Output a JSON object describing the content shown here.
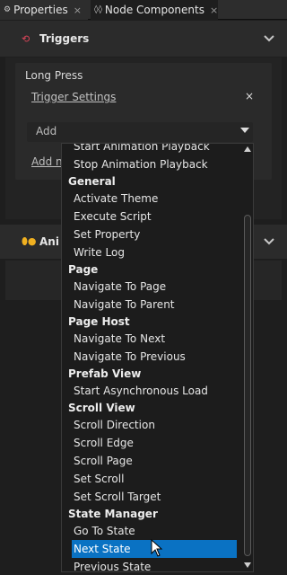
{
  "tabs": [
    {
      "label": "Properties",
      "close": "×"
    },
    {
      "label": "Node Components",
      "close": "×"
    }
  ],
  "triggers_section": {
    "title": "Triggers"
  },
  "trigger": {
    "name": "Long Press",
    "settings_link": "Trigger Settings",
    "remove": "×",
    "add_placeholder": "Add",
    "add_link": "Add n"
  },
  "animations_section": {
    "title": "Ani"
  },
  "dropdown": {
    "items": [
      {
        "type": "item",
        "label": "Start Animation Playback"
      },
      {
        "type": "item",
        "label": "Stop Animation Playback"
      },
      {
        "type": "header",
        "label": "General"
      },
      {
        "type": "item",
        "label": "Activate Theme"
      },
      {
        "type": "item",
        "label": "Execute Script"
      },
      {
        "type": "item",
        "label": "Set Property"
      },
      {
        "type": "item",
        "label": "Write Log"
      },
      {
        "type": "header",
        "label": "Page"
      },
      {
        "type": "item",
        "label": "Navigate To Page"
      },
      {
        "type": "item",
        "label": "Navigate To Parent"
      },
      {
        "type": "header",
        "label": "Page Host"
      },
      {
        "type": "item",
        "label": "Navigate To Next"
      },
      {
        "type": "item",
        "label": "Navigate To Previous"
      },
      {
        "type": "header",
        "label": "Prefab View"
      },
      {
        "type": "item",
        "label": "Start Asynchronous Load"
      },
      {
        "type": "header",
        "label": "Scroll View"
      },
      {
        "type": "item",
        "label": "Scroll Direction"
      },
      {
        "type": "item",
        "label": "Scroll Edge"
      },
      {
        "type": "item",
        "label": "Scroll Page"
      },
      {
        "type": "item",
        "label": "Set Scroll"
      },
      {
        "type": "item",
        "label": "Set Scroll Target"
      },
      {
        "type": "header",
        "label": "State Manager"
      },
      {
        "type": "item",
        "label": "Go To State"
      },
      {
        "type": "item",
        "label": "Next State",
        "selected": true
      },
      {
        "type": "item",
        "label": "Previous State"
      }
    ]
  },
  "icons": {
    "tab_components": "node-components-icon",
    "triggers": "triggers-icon",
    "animations": "animations-icon",
    "collapse": "chevron-down-icon",
    "dropdown_caret": "caret-down-icon"
  },
  "colors": {
    "selection": "#0a72c3",
    "triggers_icon": "#e0455a",
    "animations_icon": "#f0b020"
  }
}
